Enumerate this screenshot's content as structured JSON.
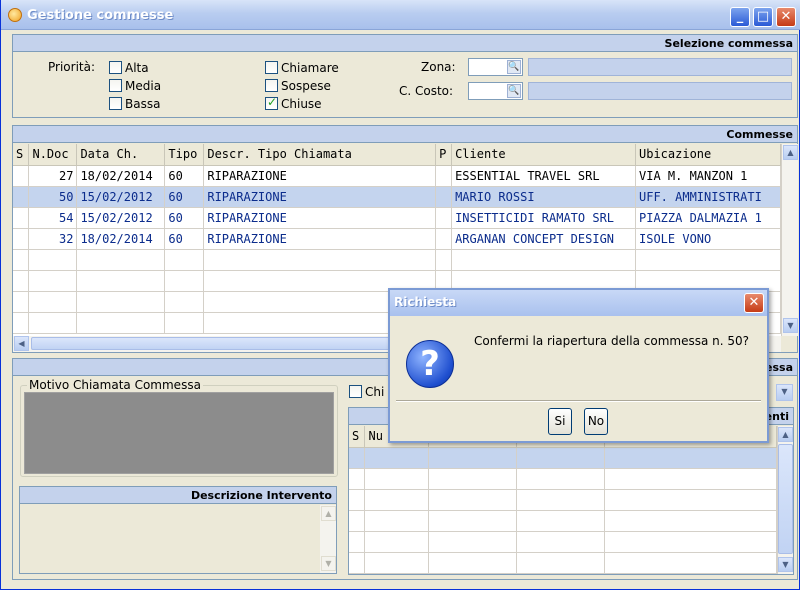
{
  "window": {
    "title": "Gestione commesse"
  },
  "selection": {
    "header": "Selezione commessa",
    "priority_label": "Priorità:",
    "priorities": [
      {
        "label": "Alta",
        "checked": false
      },
      {
        "label": "Media",
        "checked": false
      },
      {
        "label": "Bassa",
        "checked": false
      }
    ],
    "states": [
      {
        "label": "Chiamare",
        "checked": false
      },
      {
        "label": "Sospese",
        "checked": false
      },
      {
        "label": "Chiuse",
        "checked": true
      }
    ],
    "zona_label": "Zona:",
    "costo_label": "C. Costo:"
  },
  "commesse": {
    "header": "Commesse",
    "columns": [
      "S",
      "N.Doc",
      "Data Ch.",
      "Tipo",
      "Descr. Tipo Chiamata",
      "P",
      "Cliente",
      "Ubicazione"
    ],
    "rows": [
      {
        "s": "",
        "ndoc": "27",
        "data": "18/02/2014",
        "tipo": "60",
        "descr": "RIPARAZIONE",
        "p": "",
        "cliente": "ESSENTIAL TRAVEL SRL",
        "ubicazione": "VIA M. MANZON 1"
      },
      {
        "s": "",
        "ndoc": "50",
        "data": "15/02/2012",
        "tipo": "60",
        "descr": "RIPARAZIONE",
        "p": "",
        "cliente": "MARIO ROSSI",
        "ubicazione": "UFF. AMMINISTRATI"
      },
      {
        "s": "",
        "ndoc": "54",
        "data": "15/02/2012",
        "tipo": "60",
        "descr": "RIPARAZIONE",
        "p": "",
        "cliente": "INSETTICIDI RAMATO SRL",
        "ubicazione": "PIAZZA DALMAZIA 1"
      },
      {
        "s": "",
        "ndoc": "32",
        "data": "18/02/2014",
        "tipo": "60",
        "descr": "RIPARAZIONE",
        "p": "",
        "cliente": "ARGANAN CONCEPT DESIGN",
        "ubicazione": "ISOLE VONO"
      }
    ]
  },
  "lower": {
    "header_partial": "essa",
    "motivo_label": "Motivo Chiamata Commessa",
    "descr_intervento": "Descrizione Intervento",
    "chi_label": "Chi",
    "interventi_header_partial": "enti",
    "grid_columns": [
      "S",
      "Nu"
    ]
  },
  "dialog": {
    "title": "Richiesta",
    "message": "Confermi la riapertura della commessa n. 50?",
    "yes": "Si",
    "no": "No"
  }
}
